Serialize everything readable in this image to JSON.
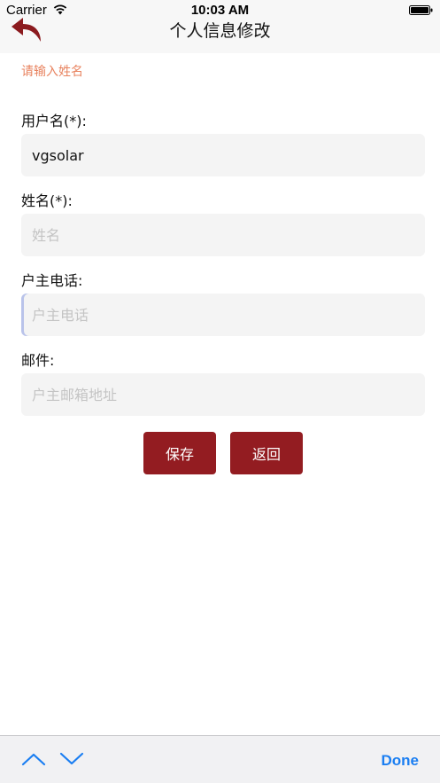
{
  "status_bar": {
    "carrier": "Carrier",
    "time": "10:03 AM"
  },
  "nav": {
    "title": "个人信息修改",
    "back_icon": "back-arrow-icon"
  },
  "form": {
    "error": "请输入姓名",
    "username_label": "用户名(*):",
    "username_value": "vgsolar",
    "name_label": "姓名(*):",
    "name_placeholder": "姓名",
    "phone_label": "户主电话:",
    "phone_placeholder": "户主电话",
    "email_label": "邮件:",
    "email_placeholder": "户主邮箱地址"
  },
  "buttons": {
    "save": "保存",
    "back": "返回"
  },
  "keyboard_toolbar": {
    "done": "Done"
  },
  "colors": {
    "accent": "#931c21",
    "error": "#e8835f",
    "link": "#1a7ef2"
  }
}
